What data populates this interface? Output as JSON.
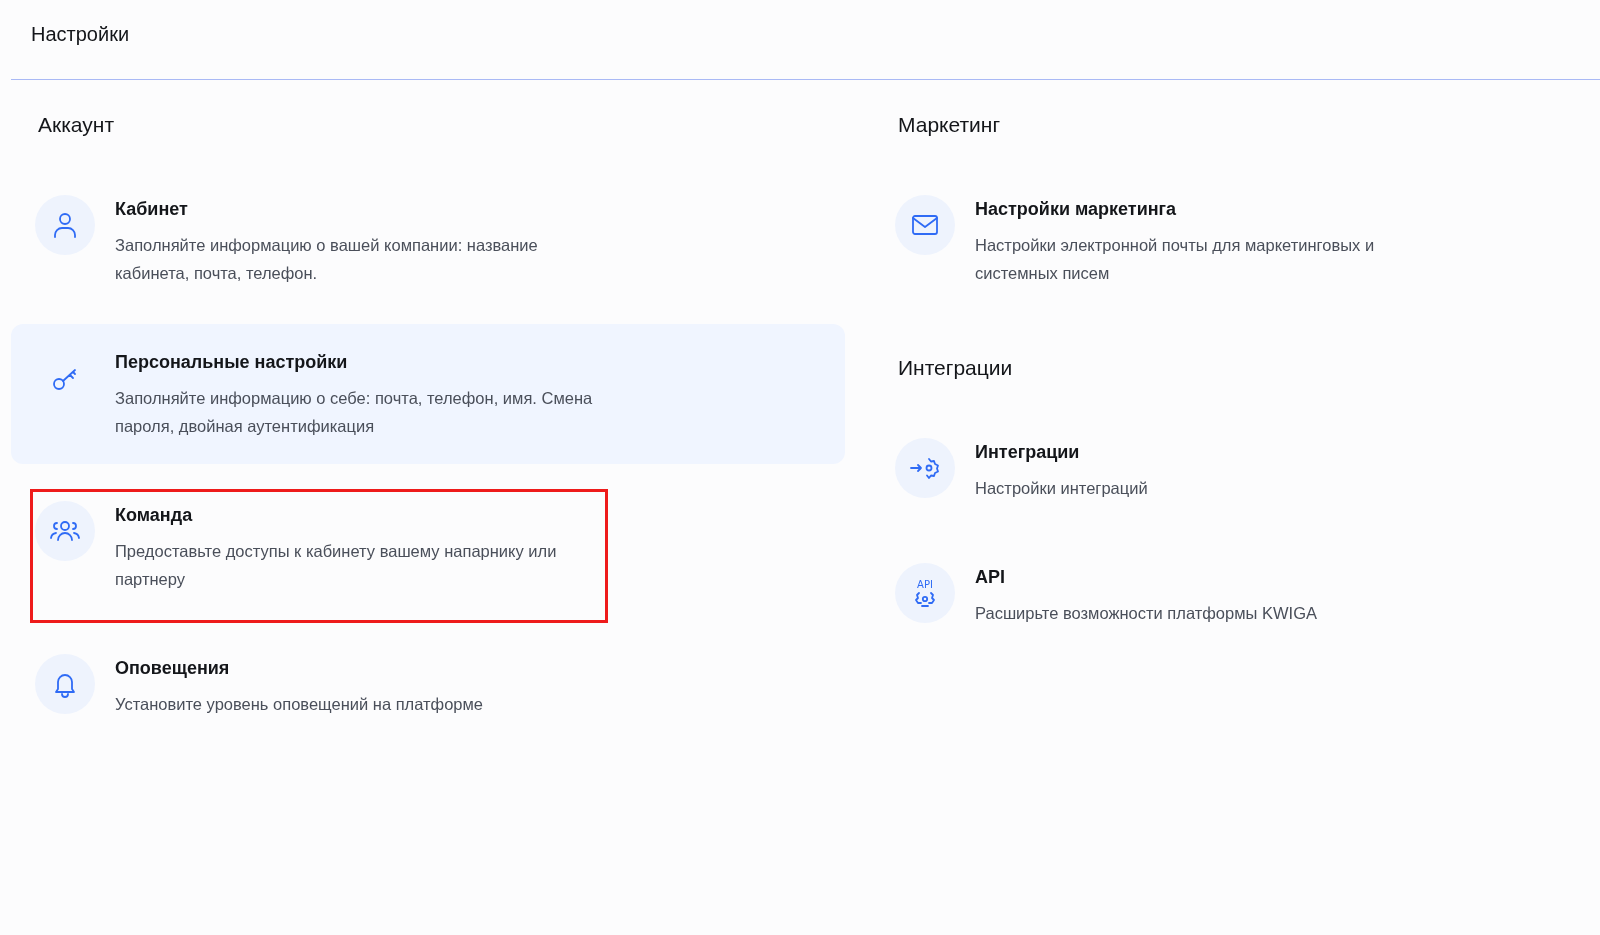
{
  "header": {
    "title": "Настройки"
  },
  "columns": [
    {
      "sections": [
        {
          "heading": "Аккаунт",
          "items": [
            {
              "title": "Кабинет",
              "description": "Заполняйте информацию о вашей компании: название кабинета, почта, телефон.",
              "selected": false,
              "outlined": false
            },
            {
              "title": "Персональные настройки",
              "description": "Заполняйте информацию о себе: почта, телефон, имя. Смена пароля, двойная аутентификация",
              "selected": true,
              "outlined": false
            },
            {
              "title": "Команда",
              "description": "Предоставьте доступы к кабинету вашему напарнику или партнеру",
              "selected": false,
              "outlined": true
            },
            {
              "title": "Оповещения",
              "description": "Установите уровень оповещений на платформе",
              "selected": false,
              "outlined": false
            }
          ]
        }
      ]
    },
    {
      "sections": [
        {
          "heading": "Маркетинг",
          "items": [
            {
              "title": "Настройки маркетинга",
              "description": "Настройки электронной почты для маркетинговых и системных писем",
              "selected": false,
              "outlined": false
            }
          ]
        },
        {
          "heading": "Интеграции",
          "items": [
            {
              "title": "Интеграции",
              "description": "Настройки интеграций",
              "selected": false,
              "outlined": false
            },
            {
              "title": "API",
              "description": "Расширьте возможности платформы KWIGA",
              "selected": false,
              "outlined": false,
              "icon_label": "API"
            }
          ]
        }
      ]
    }
  ]
}
